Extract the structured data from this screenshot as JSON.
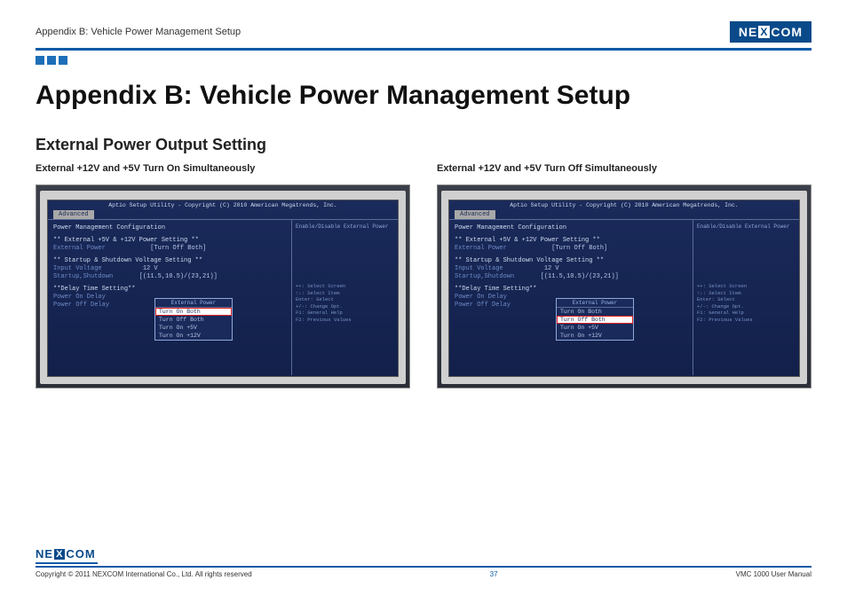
{
  "header": {
    "breadcrumb": "Appendix B: Vehicle Power Management Setup",
    "logo_text": "NE COM",
    "logo_x": "X"
  },
  "title": "Appendix B: Vehicle Power Management Setup",
  "section": "External Power Output Setting",
  "columns": [
    {
      "subhead": "External +12V and +5V Turn On Simultaneously",
      "bios": {
        "top": "Aptio Setup Utility - Copyright (C) 2010 American Megatrends, Inc.",
        "tab": "Advanced",
        "config_title": "Power Management Configuration",
        "right_help": "Enable/Disable External Power",
        "group1_title": "** External +5V & +12V Power Setting **",
        "ext_power_label": "External Power",
        "ext_power_value": "[Turn Off Both]",
        "group2_title": "** Startup & Shutdown Voltage Setting **",
        "input_voltage_label": "Input Voltage",
        "input_voltage_value": "12 V",
        "startup_label": "Startup,Shutdown",
        "startup_value": "[(11.5,10.5)/(23,21)]",
        "group3_title": "**Delay Time Setting**",
        "power_on_delay": "Power On Delay",
        "power_off_delay": "Power Off Delay",
        "popup_title": "External Power",
        "popup_items": [
          "Turn On Both",
          "Turn Off Both",
          "Turn On +5V",
          "Turn On +12V"
        ],
        "popup_selected_index": 0,
        "popup_highlight_index": 0,
        "help_keys": [
          "++: Select Screen",
          "↑↓: Select Item",
          "Enter: Select",
          "+/-: Change Opt.",
          "F1: General Help",
          "F2: Previous Values"
        ]
      }
    },
    {
      "subhead": "External +12V and +5V Turn Off Simultaneously",
      "bios": {
        "top": "Aptio Setup Utility - Copyright (C) 2010 American Megatrends, Inc.",
        "tab": "Advanced",
        "config_title": "Power Management Configuration",
        "right_help": "Enable/Disable External Power",
        "group1_title": "** External +5V & +12V Power Setting **",
        "ext_power_label": "External Power",
        "ext_power_value": "[Turn Off Both]",
        "group2_title": "** Startup & Shutdown Voltage Setting **",
        "input_voltage_label": "Input Voltage",
        "input_voltage_value": "12 V",
        "startup_label": "Startup,Shutdown",
        "startup_value": "[(11.5,10.5)/(23,21)]",
        "group3_title": "**Delay Time Setting**",
        "power_on_delay": "Power On Delay",
        "power_off_delay": "Power Off Delay",
        "popup_title": "External Power",
        "popup_items": [
          "Turn On Both",
          "Turn Off Both",
          "Turn On +5V",
          "Turn On +12V"
        ],
        "popup_selected_index": 1,
        "popup_highlight_index": 1,
        "help_keys": [
          "++: Select Screen",
          "↑↓: Select Item",
          "Enter: Select",
          "+/-: Change Opt.",
          "F1: General Help",
          "F2: Previous Values"
        ]
      }
    }
  ],
  "footer": {
    "logo_text": "NE COM",
    "logo_x": "X",
    "copyright": "Copyright © 2011 NEXCOM International Co., Ltd. All rights reserved",
    "page": "37",
    "manual": "VMC 1000 User Manual"
  }
}
